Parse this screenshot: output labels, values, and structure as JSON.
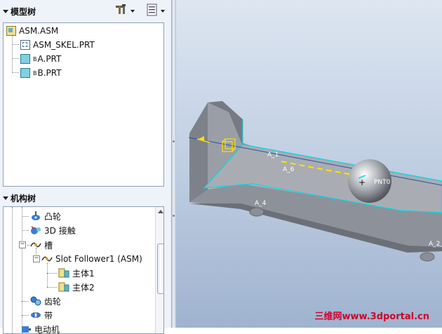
{
  "model_tree": {
    "title": "模型树",
    "items": [
      {
        "label": "ASM.ASM",
        "icon": "assembly-icon"
      },
      {
        "label": "ASM_SKEL.PRT",
        "icon": "skeleton-part-icon"
      },
      {
        "tag": "B",
        "label": "A.PRT",
        "icon": "part-icon"
      },
      {
        "tag": "B",
        "label": "B.PRT",
        "icon": "part-icon"
      }
    ]
  },
  "mech_tree": {
    "title": "机构树",
    "items": [
      {
        "label": "凸轮",
        "icon": "cam-icon"
      },
      {
        "label": "3D 接触",
        "icon": "3d-contact-icon"
      },
      {
        "label": "槽",
        "icon": "slot-icon"
      },
      {
        "label": "Slot Follower1 (ASM)",
        "icon": "slot-follower-icon"
      },
      {
        "label": "主体1",
        "icon": "body-icon"
      },
      {
        "label": "主体2",
        "icon": "body-icon"
      },
      {
        "label": "齿轮",
        "icon": "gear-icon"
      },
      {
        "label": "带",
        "icon": "belt-icon"
      },
      {
        "label": "电动机",
        "icon": "motor-icon"
      }
    ]
  },
  "viewport": {
    "labels": [
      "A_1",
      "A_6",
      "A_4",
      "PNT0",
      "A_2"
    ]
  },
  "watermark": "三维网www.3dportal.cn",
  "colors": {
    "accent": "#00d8e8",
    "datum": "#ffe000",
    "watermark": "#d0002a"
  }
}
